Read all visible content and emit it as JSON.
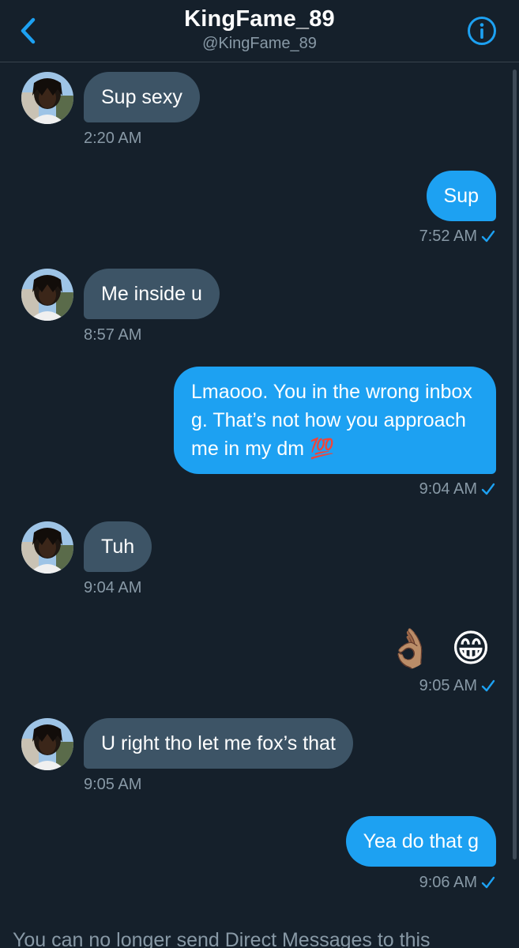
{
  "header": {
    "title": "KingFame_89",
    "handle": "@KingFame_89",
    "back_icon": "chevron-left-icon",
    "info_icon": "info-circle-icon",
    "accent": "#1da1f2"
  },
  "messages": [
    {
      "from": "them",
      "text": "Sup sexy",
      "time": "2:20 AM"
    },
    {
      "from": "me",
      "text": "Sup",
      "time": "7:52 AM"
    },
    {
      "from": "them",
      "text": "Me inside u",
      "time": "8:57 AM"
    },
    {
      "from": "me",
      "text": "Lmaooo. You in the wrong inbox g. That’s not how you approach me in my dm 💯",
      "time": "9:04 AM"
    },
    {
      "from": "them",
      "text": "Tuh",
      "time": "9:04 AM"
    },
    {
      "from": "me",
      "text": "👌🏽 😁",
      "time": "9:05 AM"
    },
    {
      "from": "them",
      "text": "U right tho let me fox’s that",
      "time": "9:05 AM"
    },
    {
      "from": "me",
      "text": "Yea do that g",
      "time": "9:06 AM"
    }
  ],
  "footer": {
    "notice": "You can no longer send Direct Messages to this"
  },
  "colors": {
    "background": "#15202b",
    "received_bubble": "#3d5466",
    "sent_bubble": "#1da1f2",
    "muted_text": "#8899a6"
  }
}
